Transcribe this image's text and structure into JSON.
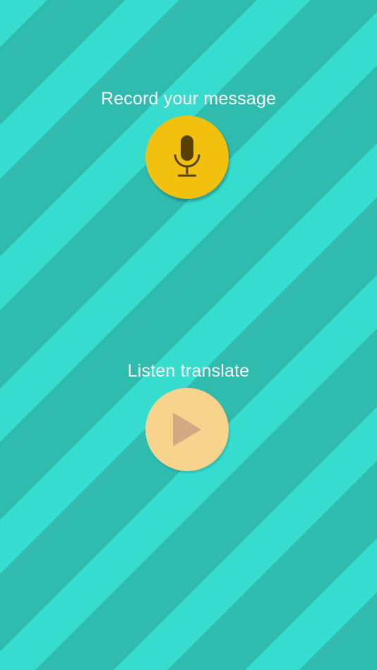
{
  "record": {
    "label": "Record your message",
    "icon": "microphone-icon",
    "color": "#f2c10f",
    "icon_color": "#5a4000"
  },
  "listen": {
    "label": "Listen translate",
    "icon": "play-icon",
    "color": "#f8d38d",
    "icon_color": "#d1aa82"
  }
}
